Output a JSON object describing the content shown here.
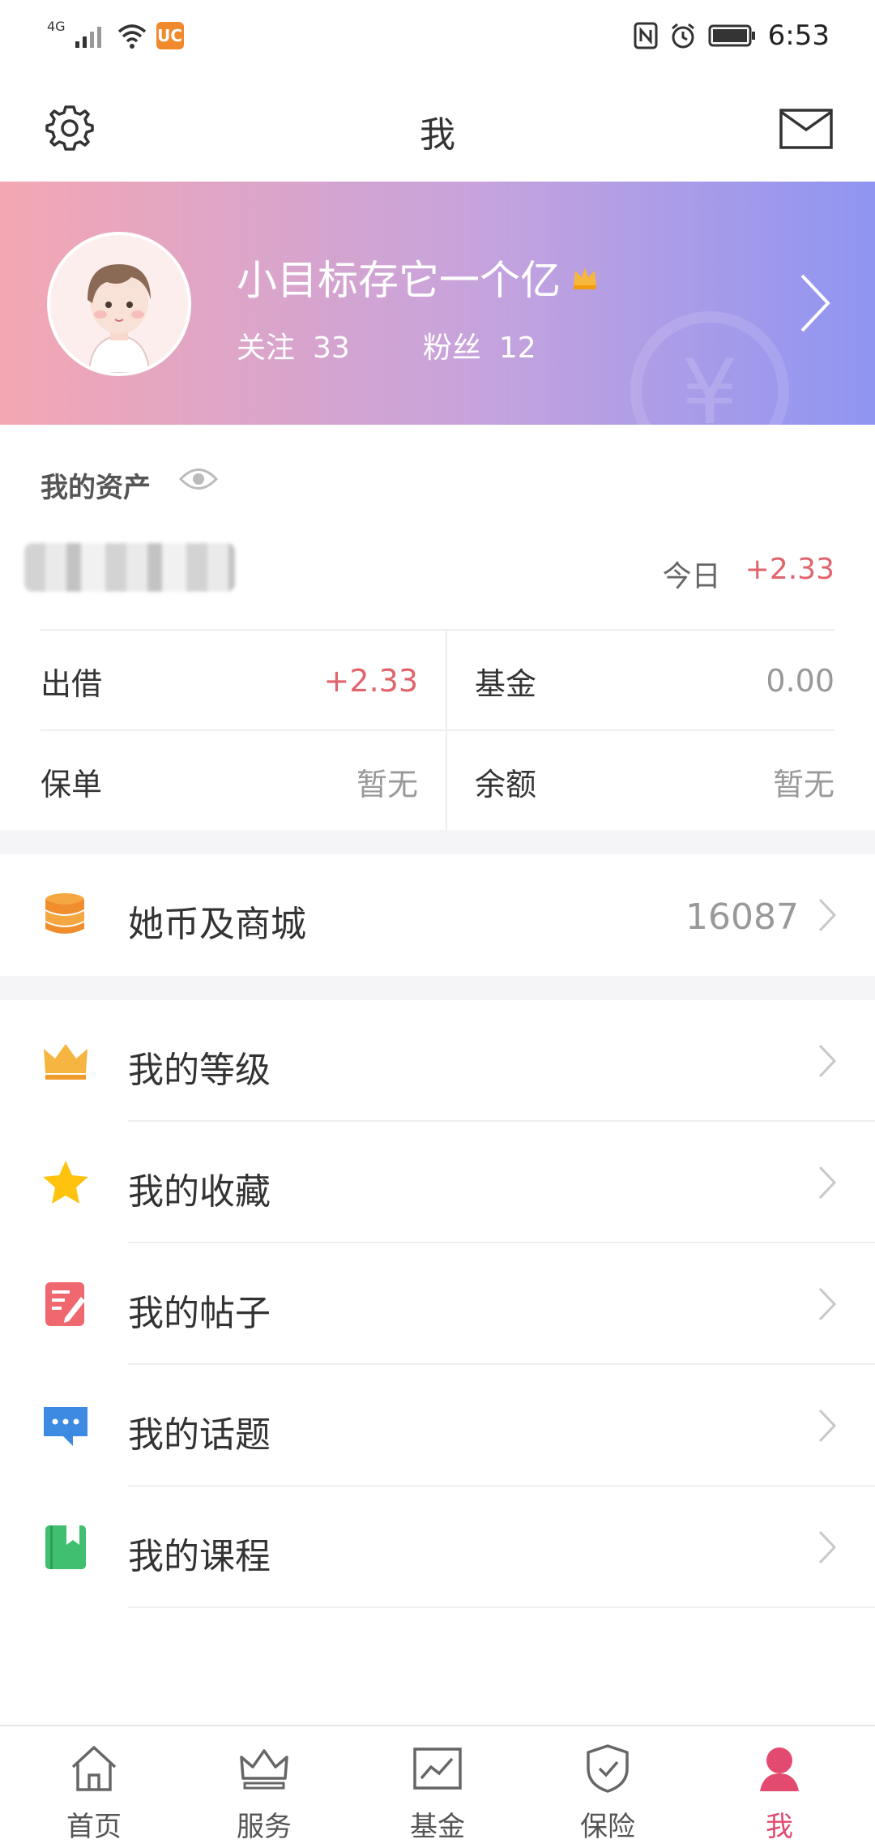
{
  "status_bar": {
    "network": "4G",
    "time": "6:53"
  },
  "header": {
    "title": "我"
  },
  "profile": {
    "username": "小目标存它一个亿",
    "follow_label": "关注",
    "follow_count": "33",
    "fans_label": "粉丝",
    "fans_count": "12",
    "watermark": "¥"
  },
  "assets": {
    "title": "我的资产",
    "today_label": "今日",
    "today_value": "+2.33",
    "items": [
      {
        "label": "出借",
        "value": "+2.33"
      },
      {
        "label": "基金",
        "value": "0.00"
      },
      {
        "label": "保单",
        "value": "暂无"
      },
      {
        "label": "余额",
        "value": "暂无"
      }
    ]
  },
  "coins": {
    "label": "她币及商城",
    "value": "16087"
  },
  "menu": [
    {
      "label": "我的等级",
      "icon": "crown-icon"
    },
    {
      "label": "我的收藏",
      "icon": "star-icon"
    },
    {
      "label": "我的帖子",
      "icon": "post-icon"
    },
    {
      "label": "我的话题",
      "icon": "chat-icon"
    },
    {
      "label": "我的课程",
      "icon": "book-icon"
    }
  ],
  "bottom_nav": [
    {
      "label": "首页",
      "icon": "home-icon"
    },
    {
      "label": "服务",
      "icon": "crown-icon"
    },
    {
      "label": "基金",
      "icon": "chart-icon"
    },
    {
      "label": "保险",
      "icon": "shield-icon"
    },
    {
      "label": "我",
      "icon": "person-icon",
      "active": true
    }
  ],
  "colors": {
    "accent": "#e24a6f",
    "positive": "#e0646b",
    "banner_start": "#f4a7b3",
    "banner_end": "#8f95f2"
  }
}
